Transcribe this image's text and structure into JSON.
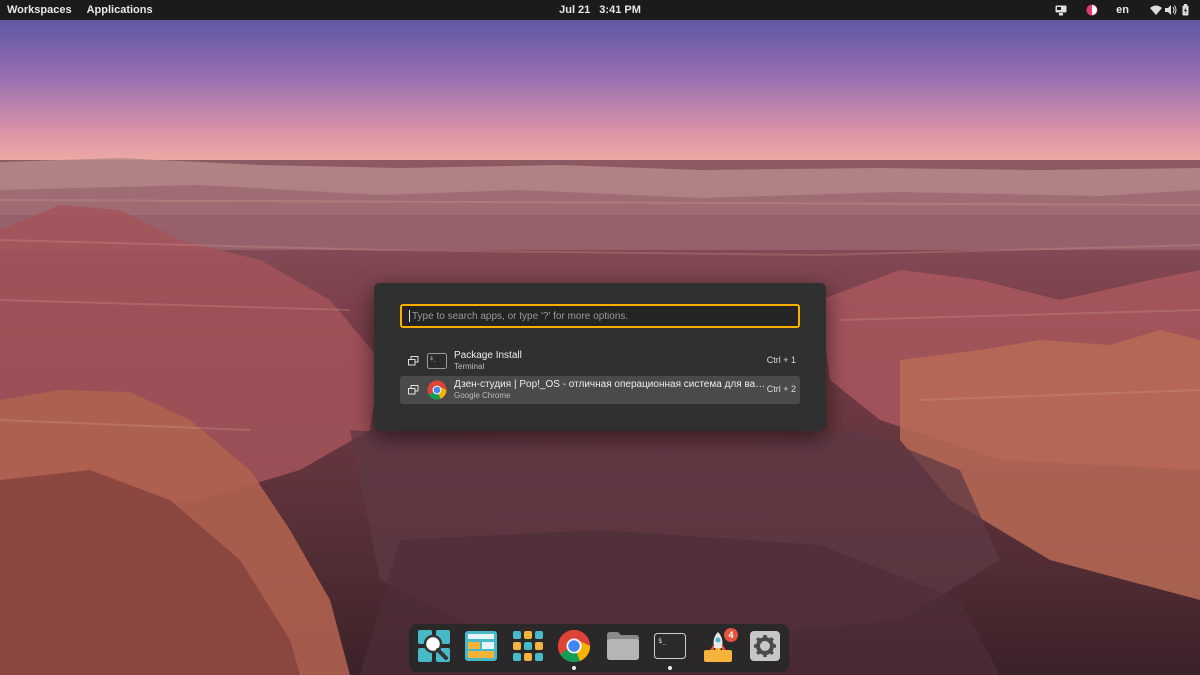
{
  "topbar": {
    "workspaces": "Workspaces",
    "applications": "Applications",
    "date": "Jul 21",
    "time": "3:41 PM",
    "language": "en",
    "tray_icons": [
      "screen-share-icon",
      "user-status-icon",
      "wifi-icon",
      "volume-icon",
      "battery-icon"
    ]
  },
  "launcher": {
    "search_placeholder": "Type to search apps, or type '?' for more options.",
    "results": [
      {
        "title": "Package Install",
        "subtitle": "Terminal",
        "shortcut": "Ctrl + 1",
        "icon": "terminal-icon"
      },
      {
        "title": "Дзен-студия | Pop!_OS - отличная операционная система для вашего ...",
        "subtitle": "Google Chrome",
        "shortcut": "Ctrl + 2",
        "icon": "chrome-icon"
      }
    ],
    "accent_color": "#ffad00"
  },
  "dock": {
    "items": [
      "launcher-search-icon",
      "pop-shop-icon",
      "app-grid-icon",
      "chrome-icon",
      "files-icon",
      "terminal-icon",
      "software-updater-icon",
      "settings-icon"
    ],
    "updates_badge": "4"
  }
}
